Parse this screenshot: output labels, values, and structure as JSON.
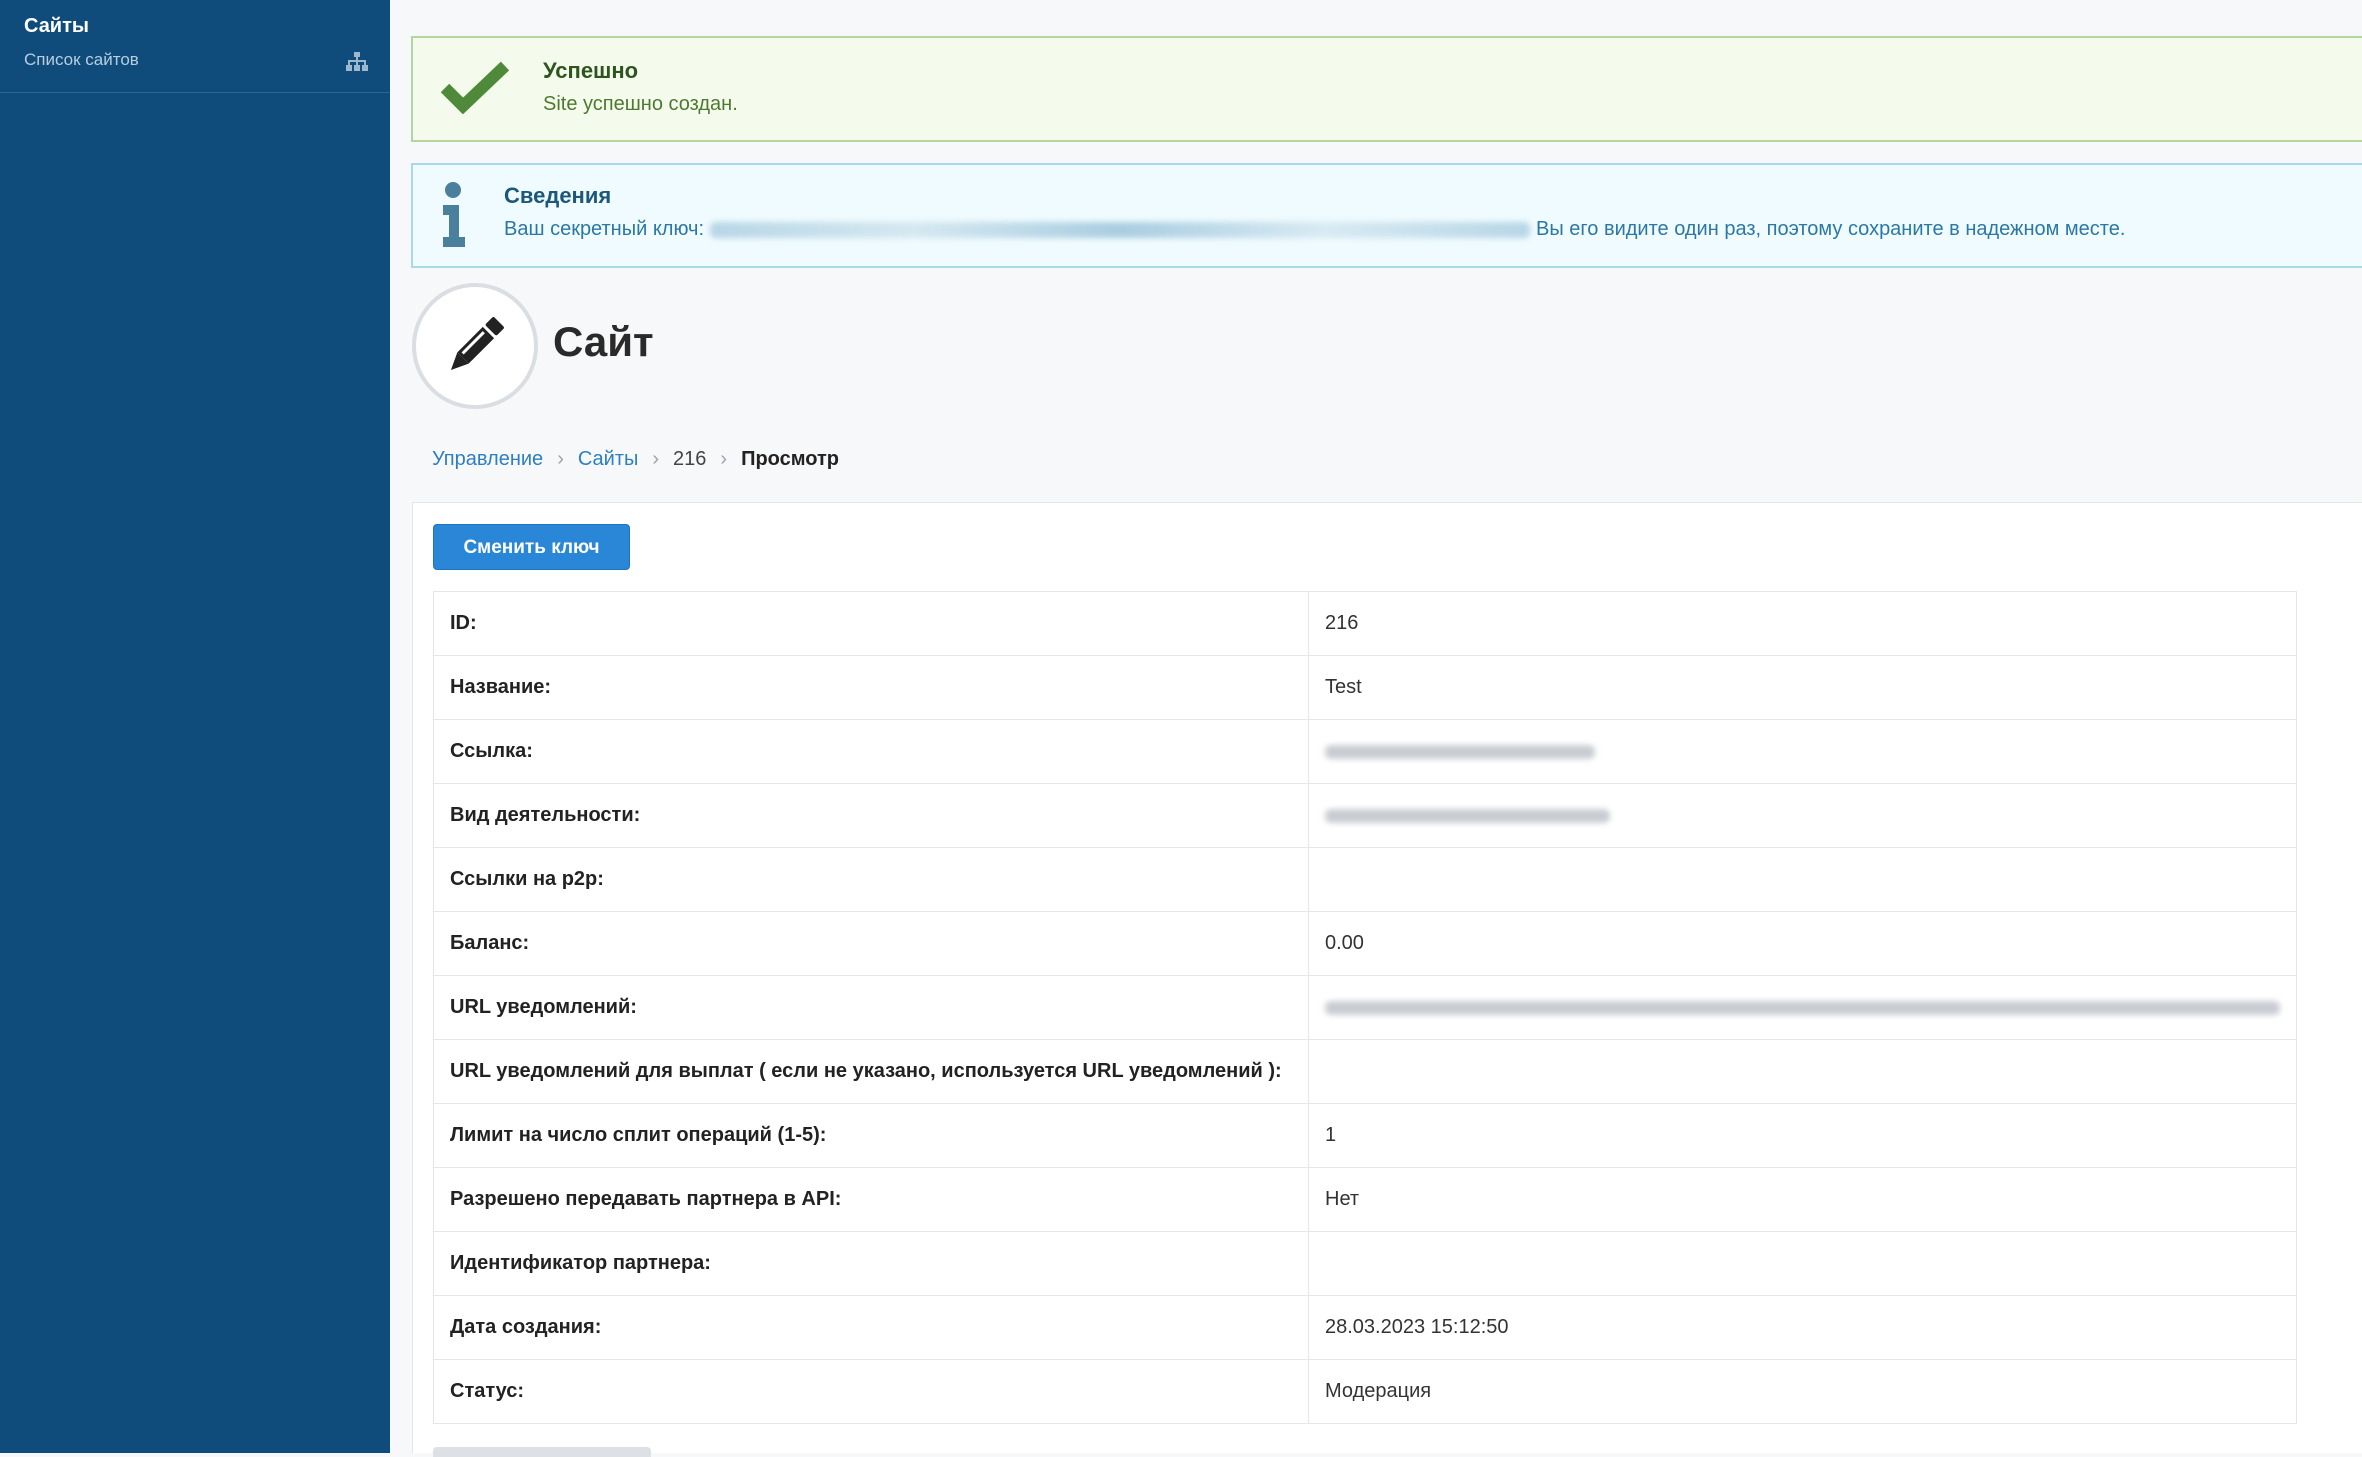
{
  "sidebar": {
    "title": "Сайты",
    "items": [
      {
        "label": "Список сайтов",
        "icon": "sitemap-icon"
      }
    ]
  },
  "alerts": {
    "success": {
      "title": "Успешно",
      "text": "Site успешно создан."
    },
    "info": {
      "title": "Сведения",
      "text_before": "Ваш секретный ключ:",
      "text_after": "Вы его видите один раз, поэтому сохраните в надежном месте."
    }
  },
  "page": {
    "title": "Сайт"
  },
  "breadcrumb": {
    "items": [
      "Управление",
      "Сайты",
      "216",
      "Просмотр"
    ]
  },
  "actions": {
    "change_key": "Сменить ключ"
  },
  "details": [
    {
      "label": "ID:",
      "value": "216"
    },
    {
      "label": "Название:",
      "value": "Test"
    },
    {
      "label": "Ссылка:",
      "value": ""
    },
    {
      "label": "Вид деятельности:",
      "value": ""
    },
    {
      "label": "Ссылки на p2p:",
      "value": ""
    },
    {
      "label": "Баланс:",
      "value": "0.00"
    },
    {
      "label": "URL уведомлений:",
      "value": ""
    },
    {
      "label": "URL уведомлений для выплат ( если не указано, используется URL уведомлений ):",
      "value": ""
    },
    {
      "label": "Лимит на число сплит операций (1-5):",
      "value": "1"
    },
    {
      "label": "Разрешено передавать партнера в API:",
      "value": "Нет"
    },
    {
      "label": "Идентификатор партнера:",
      "value": ""
    },
    {
      "label": "Дата создания:",
      "value": "28.03.2023 15:12:50"
    },
    {
      "label": "Статус:",
      "value": "Модерация"
    }
  ],
  "colors": {
    "sidebar_bg": "#0f4c7b",
    "primary": "#2a86d6",
    "success_bg": "#f5fbec",
    "info_bg": "#effbfe",
    "link": "#2d7fc1"
  }
}
